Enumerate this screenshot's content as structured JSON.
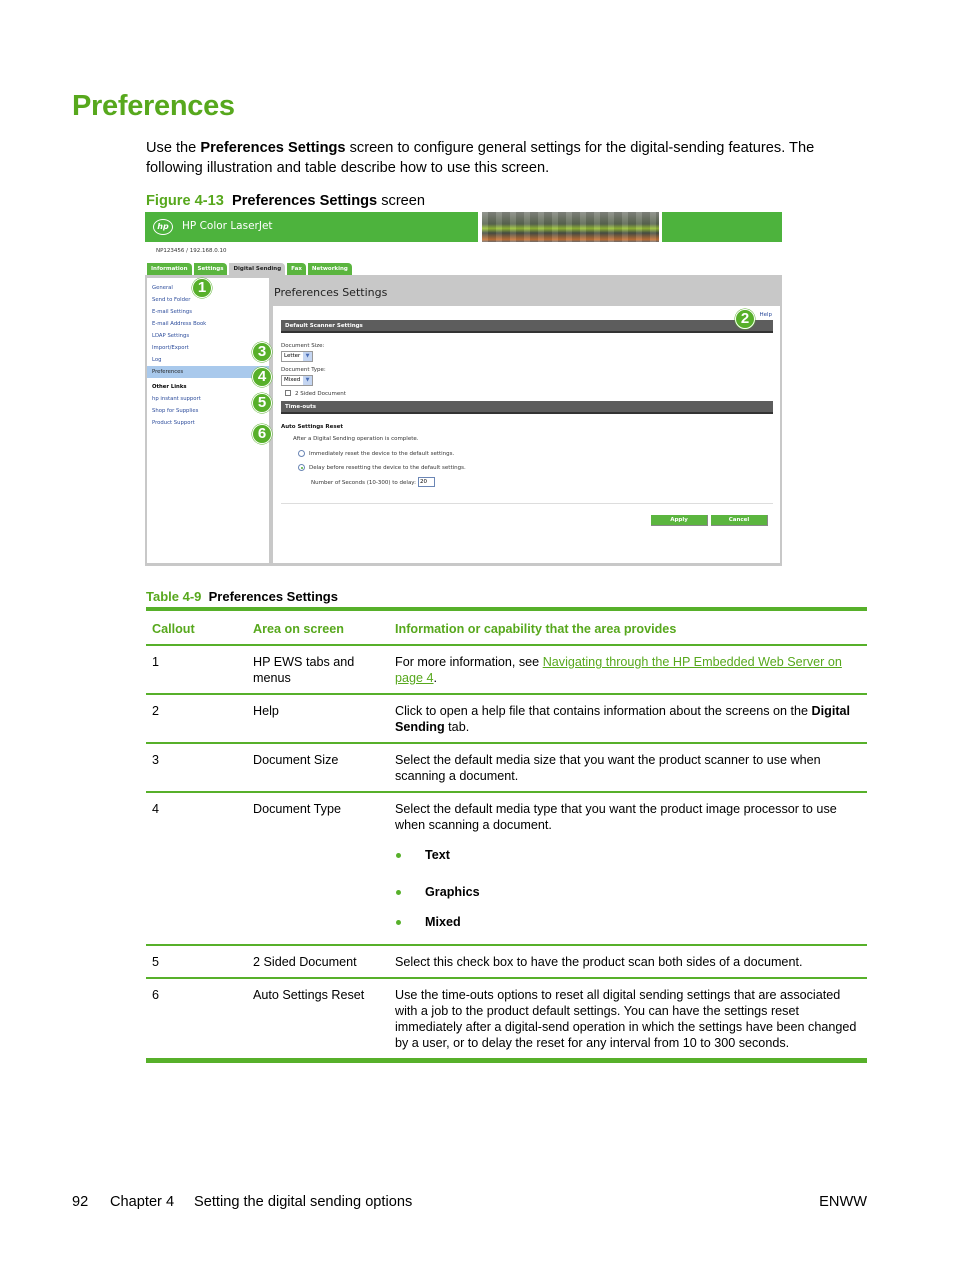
{
  "page": {
    "title": "Preferences",
    "intro": {
      "prefix": "Use the ",
      "bold": "Preferences Settings",
      "suffix": " screen to configure general settings for the digital-sending features. The following illustration and table describe how to use this screen."
    },
    "figure_caption": {
      "number": "Figure 4-13",
      "bold": "Preferences Settings",
      "suffix": " screen"
    }
  },
  "ews": {
    "logo": "hp",
    "product_name": "HP Color LaserJet",
    "device_id": "NP123456 / 192.168.0.10",
    "tabs": [
      "Information",
      "Settings",
      "Digital Sending",
      "Fax",
      "Networking"
    ],
    "active_tab": "Digital Sending",
    "nav_items": [
      "General",
      "Send to Folder",
      "E-mail Settings",
      "E-mail Address Book",
      "LDAP Settings",
      "Import/Export",
      "Log",
      "Preferences"
    ],
    "active_nav": "Preferences",
    "other_links_heading": "Other Links",
    "other_links": [
      "hp instant support",
      "Shop for Supplies",
      "Product Support"
    ],
    "main_title": "Preferences Settings",
    "help_link": "Help",
    "section_scanner": "Default Scanner Settings",
    "document_size_label": "Document Size:",
    "document_size_value": "Letter",
    "document_type_label": "Document Type:",
    "document_type_value": "Mixed",
    "two_sided_label": "2 Sided Document",
    "two_sided_checked": false,
    "section_timeouts": "Time-outs",
    "auto_reset_heading": "Auto Settings Reset",
    "auto_reset_intro": "After a Digital Sending operation is complete.",
    "radio_immediate": "Immediately reset the device to the default settings.",
    "radio_delay": "Delay before resetting the device to the default settings.",
    "selected_radio": "delay",
    "delay_label": "Number of Seconds (10-300) to delay:",
    "delay_value": "20",
    "apply_label": "Apply",
    "cancel_label": "Cancel",
    "callouts": [
      "1",
      "2",
      "3",
      "4",
      "5",
      "6"
    ]
  },
  "table": {
    "caption_number": "Table 4-9",
    "caption_title": "Preferences Settings",
    "headers": [
      "Callout",
      "Area on screen",
      "Information or capability that the area provides"
    ],
    "rows": [
      {
        "callout": "1",
        "area": "HP EWS tabs and menus",
        "info_prefix": "For more information, see ",
        "info_link": "Navigating through the HP Embedded Web Server on page 4",
        "info_suffix": "."
      },
      {
        "callout": "2",
        "area": "Help",
        "info_prefix": "Click to open a help file that contains information about the screens on the ",
        "info_bold": "Digital Sending",
        "info_suffix": " tab."
      },
      {
        "callout": "3",
        "area": "Document Size",
        "info": "Select the default media size that you want the product scanner to use when scanning a document."
      },
      {
        "callout": "4",
        "area": "Document Type",
        "info": "Select the default media type that you want the product image processor to use when scanning a document.",
        "bullets": [
          "Text",
          "Graphics",
          "Mixed"
        ]
      },
      {
        "callout": "5",
        "area": "2 Sided Document",
        "info": "Select this check box to have the product scan both sides of a document."
      },
      {
        "callout": "6",
        "area": "Auto Settings Reset",
        "info": "Use the time-outs options to reset all digital sending settings that are associated with a job to the product default settings. You can have the settings reset immediately after a digital-send operation in which the settings have been changed by a user, or to delay the reset for any interval from 10 to 300 seconds."
      }
    ]
  },
  "footer": {
    "page_number": "92",
    "chapter": "Chapter 4",
    "chapter_title": "Setting the digital sending options",
    "right": "ENWW"
  },
  "colors": {
    "hp_green": "#57a81d",
    "banner_green": "#4db33d",
    "section_gray": "#5d5d5d",
    "link_blue": "#2a4a9a"
  }
}
